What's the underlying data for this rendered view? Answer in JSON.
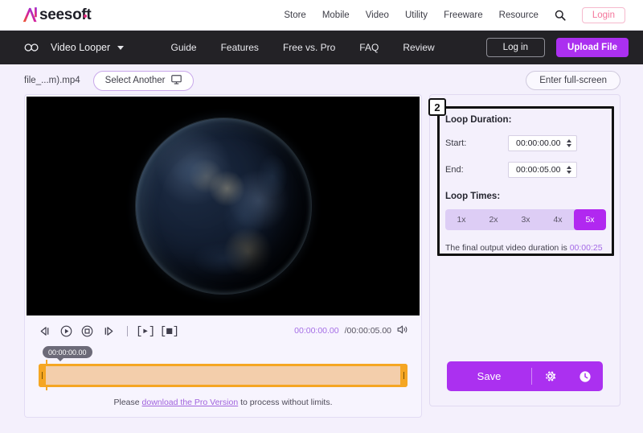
{
  "topbar": {
    "logo_text": "seesoft",
    "logo_icon": "ai-monogram-icon",
    "nav": [
      {
        "label": "Store"
      },
      {
        "label": "Mobile"
      },
      {
        "label": "Video"
      },
      {
        "label": "Utility"
      },
      {
        "label": "Freeware"
      },
      {
        "label": "Resource"
      }
    ],
    "search_icon": "search-icon",
    "login_label": "Login"
  },
  "darknav": {
    "loop_icon": "infinity-loop-icon",
    "product": "Video Looper",
    "links": [
      {
        "label": "Guide"
      },
      {
        "label": "Features"
      },
      {
        "label": "Free vs. Pro"
      },
      {
        "label": "FAQ"
      },
      {
        "label": "Review"
      }
    ],
    "login_label": "Log in",
    "upload_label": "Upload File"
  },
  "filerow": {
    "filename": "file_...m).mp4",
    "select_another_label": "Select Another",
    "monitor_icon": "monitor-icon",
    "fullscreen_label": "Enter full-screen"
  },
  "player": {
    "controls": [
      {
        "name": "previous-frame-button",
        "glyph": "prev-frame-icon"
      },
      {
        "name": "play-button",
        "glyph": "play-circle-icon"
      },
      {
        "name": "stop-button",
        "glyph": "stop-circle-icon"
      },
      {
        "name": "next-frame-button",
        "glyph": "next-frame-icon"
      }
    ],
    "set_start_label": "[▸]",
    "set_end_label": "[◼]",
    "current_time": "00:00:00.00",
    "total_time": "/00:00:05.00",
    "volume_icon": "volume-icon",
    "timeline_tooltip": "00:00:00.00",
    "pro_note_prefix": "Please ",
    "pro_note_link": "download the Pro Version",
    "pro_note_suffix": " to process without limits."
  },
  "panel": {
    "step_number": "2",
    "loop_duration_title": "Loop Duration:",
    "start_label": "Start:",
    "start_value": "00:00:00.00",
    "end_label": "End:",
    "end_value": "00:00:05.00",
    "loop_times_title": "Loop Times:",
    "loop_options": [
      {
        "label": "1x",
        "active": false
      },
      {
        "label": "2x",
        "active": false
      },
      {
        "label": "3x",
        "active": false
      },
      {
        "label": "4x",
        "active": false
      },
      {
        "label": "5x",
        "active": true
      }
    ],
    "final_note_text": "The final output video duration is ",
    "final_duration": "00:00:25",
    "save_label": "Save",
    "settings_icon": "gear-icon",
    "history_icon": "clock-icon"
  },
  "colors": {
    "accent_purple": "#ab30f0",
    "light_purple": "#a46ae6",
    "timeline_orange": "#f5a623",
    "page_bg": "#f4f0fc",
    "dark_nav": "#232226"
  }
}
